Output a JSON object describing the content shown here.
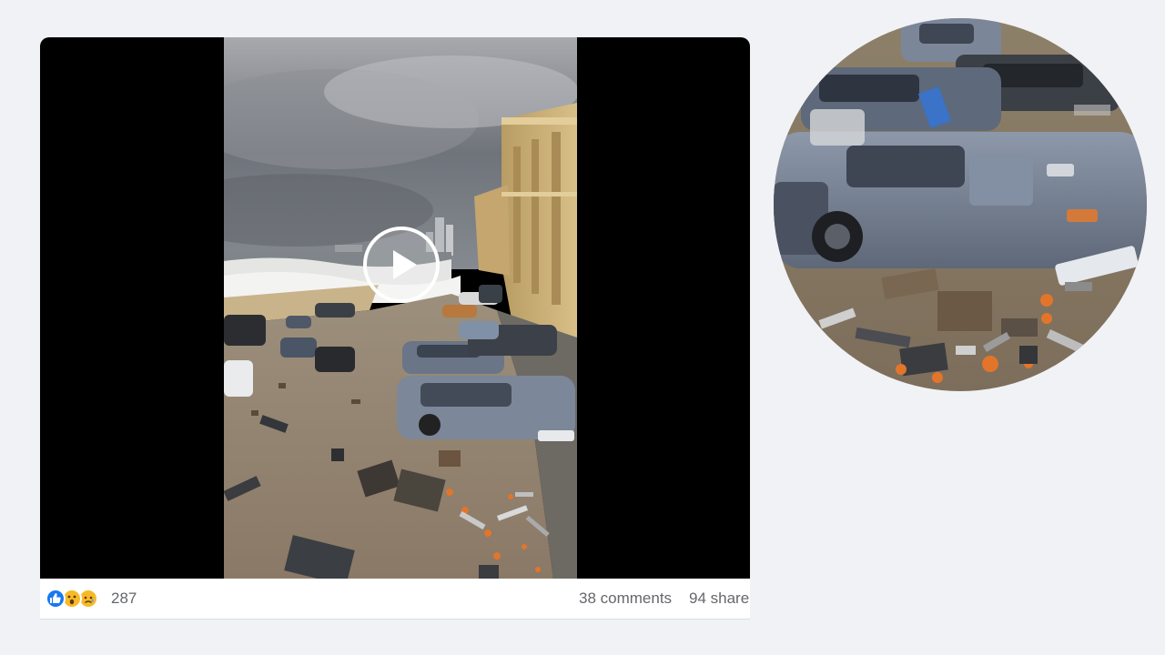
{
  "post": {
    "video": {
      "play_icon": "play-icon"
    },
    "reactions": {
      "icons": [
        "like-icon",
        "wow-icon",
        "sad-icon"
      ],
      "count": "287"
    },
    "comments_label": "38 comments",
    "shares_label": "94 share"
  },
  "zoom": {
    "shape": "circle"
  },
  "colors": {
    "page_background": "#f1f2f5",
    "like_blue": "#1877f2",
    "emoji_yellow": "#f7b928",
    "meta_text": "#65676b",
    "video_letterbox": "#000000"
  }
}
